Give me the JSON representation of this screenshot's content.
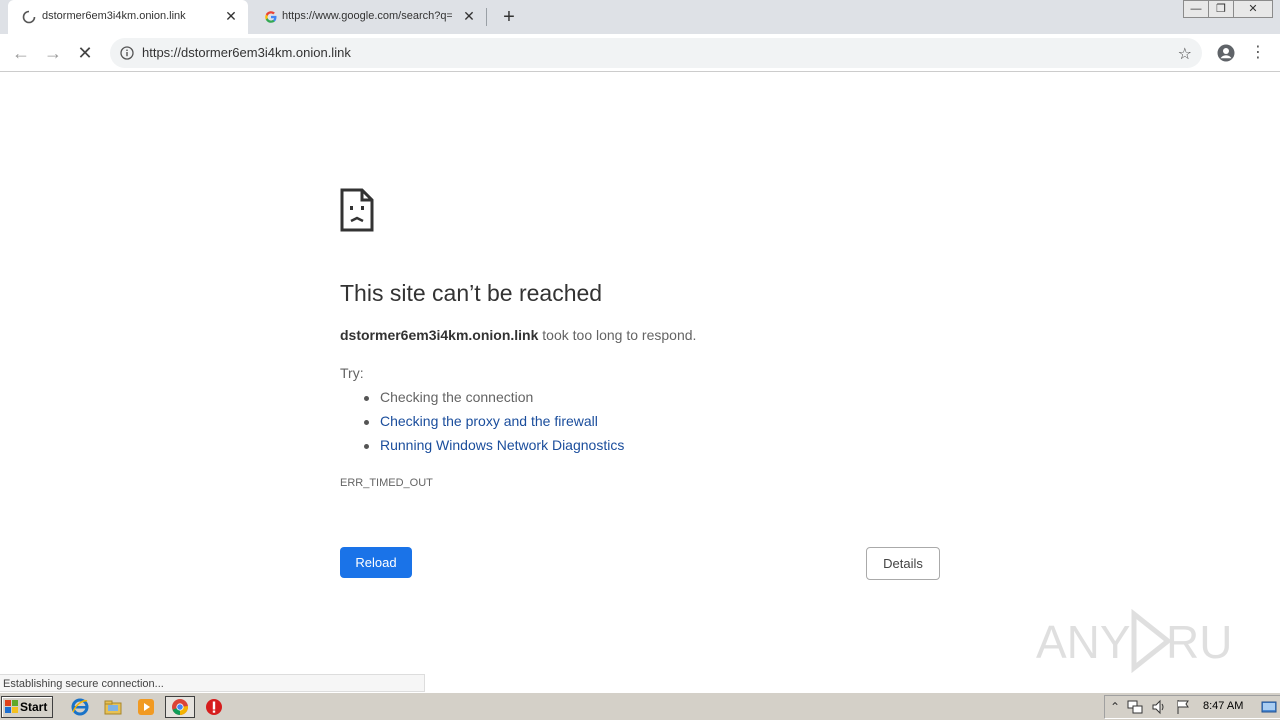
{
  "browser": {
    "tabs": [
      {
        "title": "dstormer6em3i4km.onion.link",
        "loading": true,
        "active": true
      },
      {
        "title": "https://www.google.com/search?q=",
        "favicon": "google-g-icon",
        "active": false
      }
    ],
    "new_tab_label": "+",
    "window_controls": {
      "minimize": "—",
      "restore": "❐",
      "close": "✕"
    },
    "omnibox": {
      "url": "https://dstormer6em3i4km.onion.link"
    }
  },
  "error_page": {
    "title": "This site can’t be reached",
    "host": "dstormer6em3i4km.onion.link",
    "message": " took too long to respond.",
    "try_label": "Try:",
    "suggestions": [
      {
        "text": "Checking the connection",
        "link": false
      },
      {
        "text": "Checking the proxy and the firewall",
        "link": true
      },
      {
        "text": "Running Windows Network Diagnostics",
        "link": true
      }
    ],
    "error_code": "ERR_TIMED_OUT",
    "reload_label": "Reload",
    "details_label": "Details",
    "reload_color": "#1a73e8",
    "link_color": "#1a4d9c"
  },
  "status_bubble": "Establishing secure connection...",
  "taskbar": {
    "start_label": "Start",
    "apps": [
      "ie-icon",
      "explorer-folder-icon",
      "media-player-icon",
      "chrome-icon",
      "stop-icon"
    ],
    "clock": "8:47 AM"
  }
}
